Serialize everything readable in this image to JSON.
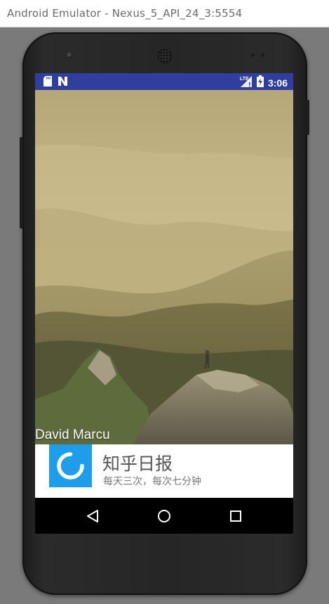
{
  "window": {
    "title": "Android Emulator - Nexus_5_API_24_3:5554"
  },
  "statusbar": {
    "time": "3:06",
    "left_icons": [
      "sd-card-icon",
      "notification-n-icon"
    ],
    "right_icons": [
      "lte-signal-icon",
      "battery-charging-icon"
    ],
    "color": "#303f9f"
  },
  "splash": {
    "photo_credit": "David Marcu"
  },
  "brand": {
    "app_name": "知乎日报",
    "slogan": "每天三次，每次七分钟",
    "logo_color": "#1e9eea"
  },
  "navbar": {
    "buttons": [
      "back-icon",
      "home-icon",
      "recents-icon"
    ]
  }
}
